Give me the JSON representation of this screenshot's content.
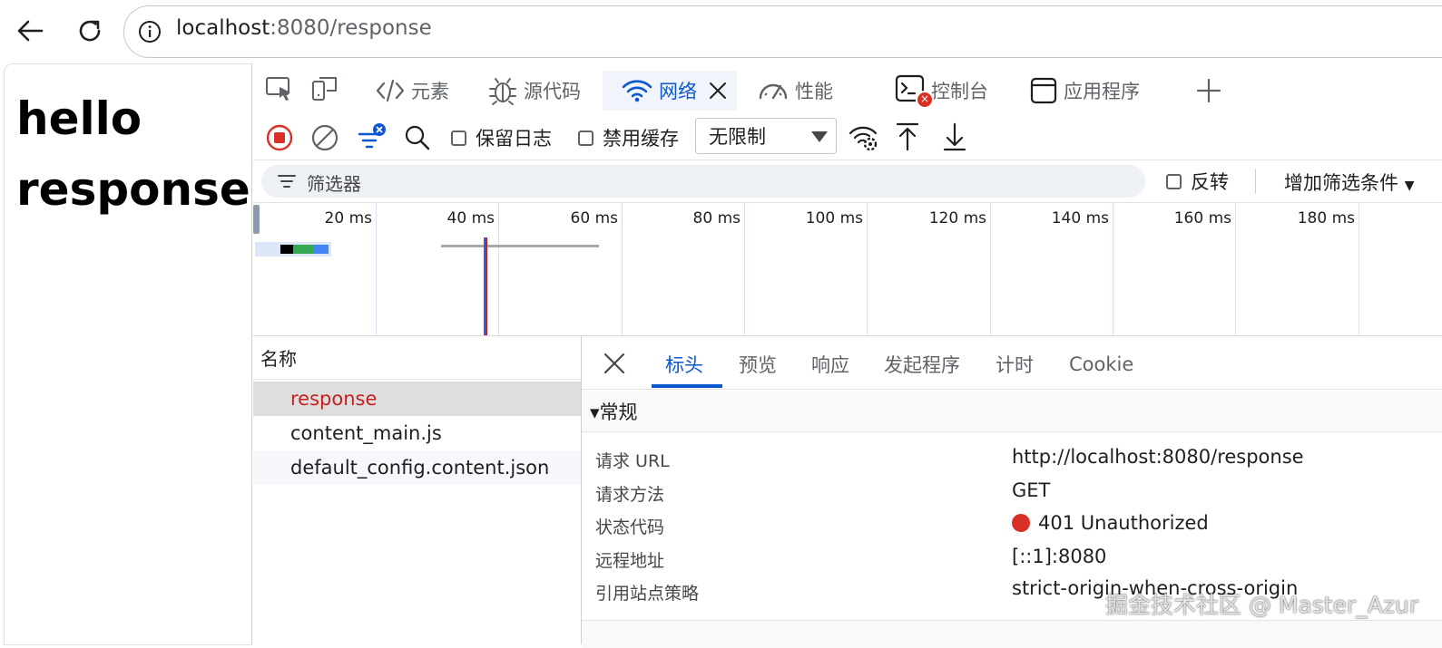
{
  "browser": {
    "url_host": "localhost",
    "url_path": ":8080/response",
    "back_icon": "arrow-left-icon",
    "reload_icon": "reload-icon",
    "info_icon": "info-icon"
  },
  "page": {
    "heading": "hello response"
  },
  "devtools": {
    "tabs": [
      {
        "label": "元素",
        "icon": "code-icon"
      },
      {
        "label": "源代码",
        "icon": "bug-icon"
      },
      {
        "label": "网络",
        "icon": "wifi-icon",
        "active": true
      },
      {
        "label": "性能",
        "icon": "gauge-icon"
      },
      {
        "label": "控制台",
        "icon": "console-icon"
      },
      {
        "label": "应用程序",
        "icon": "app-icon"
      }
    ],
    "toolbar": {
      "preserve_log": "保留日志",
      "disable_cache": "禁用缓存",
      "throttle_value": "无限制"
    },
    "filter": {
      "placeholder": "筛选器",
      "invert": "反转",
      "more_filters": "增加筛选条件"
    },
    "timeline": {
      "ticks_ms": [
        "20 ms",
        "40 ms",
        "60 ms",
        "80 ms",
        "100 ms",
        "120 ms",
        "140 ms",
        "160 ms",
        "180 ms"
      ]
    },
    "requests": {
      "header": "名称",
      "items": [
        "response",
        "content_main.js",
        "default_config.content.json"
      ],
      "selected": "response"
    },
    "details": {
      "tabs": [
        "标头",
        "预览",
        "响应",
        "发起程序",
        "计时",
        "Cookie"
      ],
      "active_tab": "标头",
      "general_title": "▾常规",
      "rows": [
        {
          "key": "请求 URL",
          "value": "http://localhost:8080/response"
        },
        {
          "key": "请求方法",
          "value": "GET"
        },
        {
          "key": "状态代码",
          "value": "401 Unauthorized"
        },
        {
          "key": "远程地址",
          "value": "[::1]:8080"
        },
        {
          "key": "引用站点策略",
          "value": "strict-origin-when-cross-origin"
        }
      ],
      "status_color": "#d93025"
    }
  },
  "watermark": "掘金技术社区 @ Master_Azur",
  "colors": {
    "accent": "#0b57d0",
    "selected_request": "#c5221f",
    "record_red": "#d93025"
  }
}
